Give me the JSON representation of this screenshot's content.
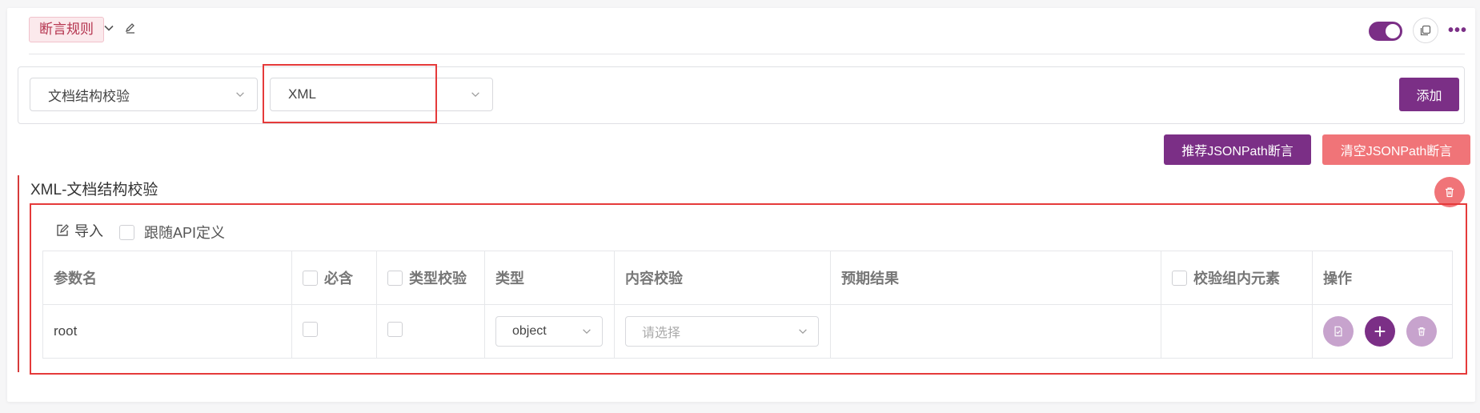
{
  "header": {
    "tag_label": "断言规则",
    "icons": [
      "chevron-down-icon",
      "edit-icon",
      "toggle-switch",
      "copy-icon",
      "more-icon"
    ],
    "toggle_on": true,
    "more_label": "•••"
  },
  "assert_bar": {
    "type_select": {
      "value": "文档结构校验"
    },
    "format_select": {
      "value": "XML"
    },
    "add_button": "添加"
  },
  "jsonpath_buttons": {
    "recommend": "推荐JSONPath断言",
    "clear": "清空JSONPath断言"
  },
  "section": {
    "title": "XML-文档结构校验",
    "import_label": "导入",
    "follow_api_label": "跟随API定义"
  },
  "table": {
    "headers": {
      "param_name": "参数名",
      "required": "必含",
      "type_check": "类型校验",
      "type": "类型",
      "content_check": "内容校验",
      "expected": "预期结果",
      "group_check": "校验组内元素",
      "actions": "操作"
    },
    "rows": [
      {
        "param_name": "root",
        "type_value": "object",
        "content_placeholder": "请选择",
        "expected": "",
        "add_symbol": "+"
      }
    ]
  },
  "colors": {
    "brand_purple": "#7b2f86",
    "danger_red": "#f07478",
    "highlight_red": "#e53a3a"
  }
}
